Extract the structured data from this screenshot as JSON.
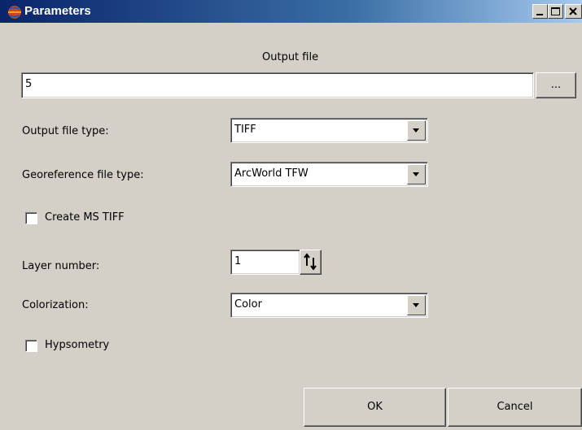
{
  "window": {
    "title": "Parameters",
    "icons": {
      "app": "globe-icon",
      "minimize": "minimize-icon",
      "maximize": "maximize-icon",
      "close": "close-icon"
    }
  },
  "output_file": {
    "heading": "Output file",
    "value": "5",
    "browse_label": "..."
  },
  "output_file_type": {
    "label": "Output file type:",
    "selected": "TIFF"
  },
  "georeference_file_type": {
    "label": "Georeference file type:",
    "selected": "ArcWorld TFW"
  },
  "create_ms_tiff": {
    "label": "Create MS TIFF",
    "checked": false
  },
  "layer_number": {
    "label": "Layer number:",
    "value": "1",
    "icon": "spin-arrows-icon"
  },
  "colorization": {
    "label": "Colorization:",
    "selected": "Color"
  },
  "hypsometry": {
    "label": "Hypsometry",
    "checked": false
  },
  "buttons": {
    "ok": "OK",
    "cancel": "Cancel"
  }
}
